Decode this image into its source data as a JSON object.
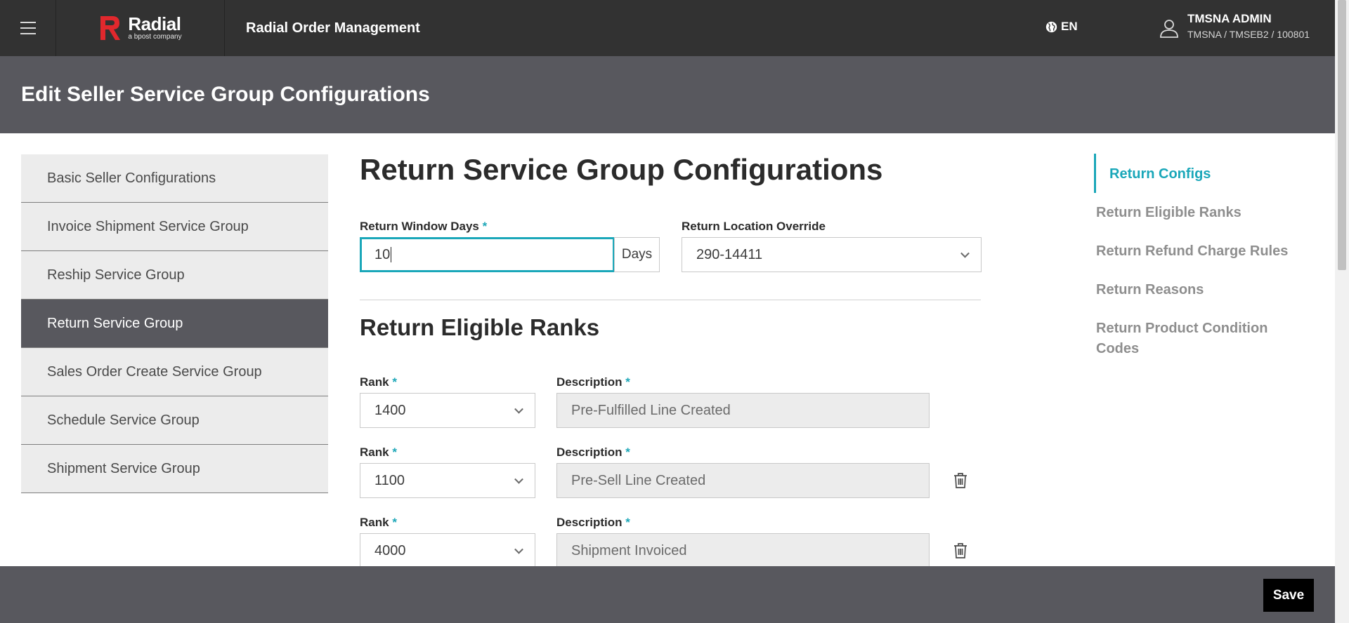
{
  "topbar": {
    "logo_name": "Radial",
    "logo_tagline": "a bpost company",
    "app_title": "Radial Order Management",
    "language": "EN",
    "user_name": "TMSNA ADMIN",
    "user_path": "TMSNA / TMSEB2 / 100801"
  },
  "page": {
    "title": "Edit Seller Service Group Configurations"
  },
  "sidebar": {
    "items": [
      {
        "label": "Basic Seller Configurations",
        "active": false
      },
      {
        "label": "Invoice Shipment Service Group",
        "active": false
      },
      {
        "label": "Reship Service Group",
        "active": false
      },
      {
        "label": "Return Service Group",
        "active": true
      },
      {
        "label": "Sales Order Create Service Group",
        "active": false
      },
      {
        "label": "Schedule Service Group",
        "active": false
      },
      {
        "label": "Shipment Service Group",
        "active": false
      }
    ]
  },
  "main": {
    "title": "Return Service Group Configurations",
    "return_window": {
      "label": "Return Window Days",
      "required": "*",
      "value": "10",
      "addon": "Days"
    },
    "return_location": {
      "label": "Return Location Override",
      "value": "290-14411"
    },
    "ranks_title": "Return Eligible Ranks",
    "rank_label": "Rank",
    "description_label": "Description",
    "required": "*",
    "ranks": [
      {
        "rank": "1400",
        "description": "Pre-Fulfilled Line Created"
      },
      {
        "rank": "1100",
        "description": "Pre-Sell Line Created"
      },
      {
        "rank": "4000",
        "description": "Shipment Invoiced"
      }
    ]
  },
  "rightnav": {
    "items": [
      {
        "label": "Return Configs",
        "active": true
      },
      {
        "label": "Return Eligible Ranks",
        "active": false
      },
      {
        "label": "Return Refund Charge Rules",
        "active": false
      },
      {
        "label": "Return Reasons",
        "active": false
      },
      {
        "label": "Return Product Condition",
        "active": false
      },
      {
        "label": "Codes",
        "active": false
      }
    ]
  },
  "footer": {
    "save_label": "Save"
  },
  "colors": {
    "accent": "#1aa7b9",
    "header": "#323232",
    "page_header": "#58585e",
    "logo_red": "#e1282d"
  }
}
